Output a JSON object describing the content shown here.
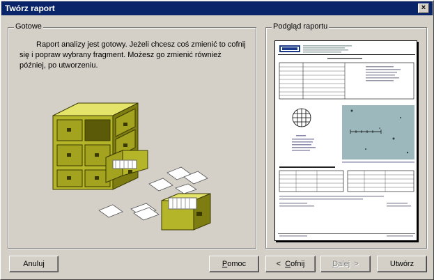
{
  "window": {
    "title": "Twórz raport",
    "close_label": "×"
  },
  "left_group": {
    "legend": "Gotowe",
    "message": "Raport analizy jest gotowy. Jeżeli chcesz coś zmienić to cofnij się i popraw wybrany fragment. Możesz go zmienić również później, po utworzeniu."
  },
  "right_group": {
    "legend": "Podgląd raportu"
  },
  "buttons": {
    "cancel": "Anuluj",
    "help_u": "P",
    "help_rest": "omoc",
    "back_arrow": "<",
    "back_u": "C",
    "back_rest": "ofnij",
    "next_u": "D",
    "next_rest": "alej",
    "next_arrow": ">",
    "create": "Utwórz"
  },
  "colors": {
    "cabinet": "#b5b52a",
    "cabinet_dark": "#7d7d12",
    "titlebar": "#0a246a",
    "micro_bg": "#9db8bc"
  }
}
